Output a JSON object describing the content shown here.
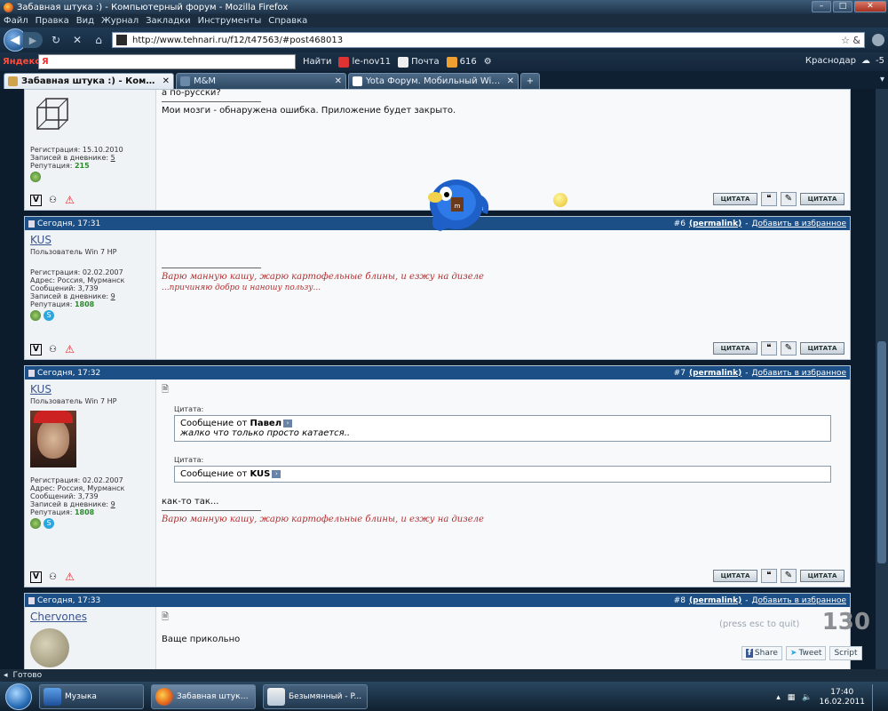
{
  "window": {
    "title": "Забавная штука :) - Компьютерный форум - Mozilla Firefox",
    "min": "–",
    "max": "□",
    "close": "✕"
  },
  "menu": [
    "Файл",
    "Правка",
    "Вид",
    "Журнал",
    "Закладки",
    "Инструменты",
    "Справка"
  ],
  "nav": {
    "url": "http://www.tehnari.ru/f12/t47563/#post468013",
    "url_tail": "☆ &"
  },
  "yandex": {
    "logo": "Яндекс",
    "input": "Я",
    "search": "Найти",
    "user": "le-nov11",
    "mail": "Почта",
    "count": "616",
    "city": "Краснодар",
    "temp": "-5"
  },
  "tabs": [
    {
      "label": "Забавная штука :) - Компьютерн...",
      "close": "✕"
    },
    {
      "label": "M&M",
      "close": "✕"
    },
    {
      "label": "Yota Форум. Мобильный WiMAX ...",
      "close": "✕"
    }
  ],
  "newtab": "+",
  "posts": {
    "p1": {
      "reg": "Регистрация: 15.10.2010",
      "diary_label": "Записей в дневнике:",
      "diary": "5",
      "rep_label": "Репутация:",
      "rep": "215",
      "line1": "а по-русски?",
      "line2": "Мои мозги - обнаружена ошибка. Приложение будет закрыто."
    },
    "p6": {
      "date": "Сегодня, 17:31",
      "num": "#6",
      "permalink": "(permalink)",
      "fav": "Добавить в избранное",
      "user": "KUS",
      "title": "Пользователь Win 7 HP",
      "reg": "Регистрация: 02.02.2007",
      "addr": "Адрес: Россия, Мурманск",
      "msgs": "Сообщений: 3,739",
      "diary_label": "Записей в дневнике:",
      "diary": "9",
      "rep_label": "Репутация:",
      "rep": "1808",
      "sig1": "Варю манную кашу, жарю картофельные блины, и езжу на дизеле",
      "sig2": "...причиняю добро и наношу пользу..."
    },
    "p7": {
      "date": "Сегодня, 17:32",
      "num": "#7",
      "permalink": "(permalink)",
      "fav": "Добавить в избранное",
      "user": "KUS",
      "title": "Пользователь Win 7 HP",
      "reg": "Регистрация: 02.02.2007",
      "addr": "Адрес: Россия, Мурманск",
      "msgs": "Сообщений: 3,739",
      "diary_label": "Записей в дневнике:",
      "diary": "9",
      "rep_label": "Репутация:",
      "rep": "1808",
      "q1_label": "Цитата:",
      "q1_from": "Сообщение от",
      "q1_user": "Павел",
      "q1_text": "жалко что только просто катается..",
      "q2_label": "Цитата:",
      "q2_from": "Сообщение от",
      "q2_user": "KUS",
      "text": "как-то так...",
      "sig1": "Варю манную кашу, жарю картофельные блины, и езжу на дизеле"
    },
    "p8": {
      "date": "Сегодня, 17:33",
      "num": "#8",
      "permalink": "(permalink)",
      "fav": "Добавить в избранное",
      "user": "Chervones",
      "text": "Ваще прикольно"
    }
  },
  "quote_btn": "ЦИТАТА",
  "counter": {
    "hint": "(press esc to quit)",
    "num": "130"
  },
  "share": {
    "fb": "Share",
    "tw": "Tweet",
    "script": "Script"
  },
  "status": "Готово",
  "taskbar": {
    "items": [
      {
        "label": "Музыка"
      },
      {
        "label": "Забавная штука :..."
      },
      {
        "label": "Безымянный - P..."
      }
    ],
    "time": "17:40",
    "date": "16.02.2011"
  },
  "colors": {
    "post_header": "#1c4f86",
    "signature": "#b03030",
    "reputation": "#2b8a2b",
    "username": "#3a5590"
  }
}
